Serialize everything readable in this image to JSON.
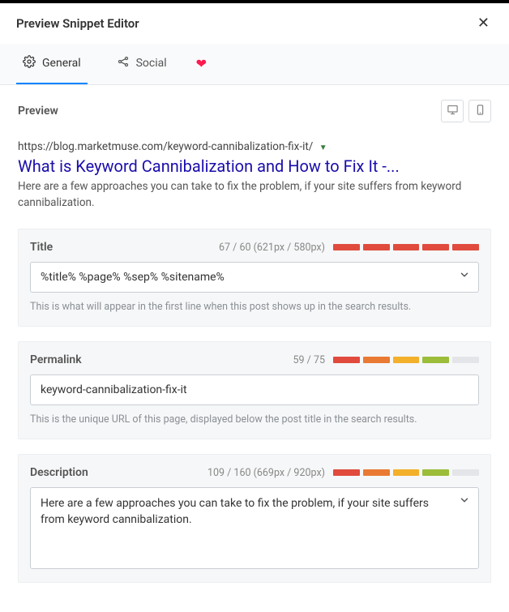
{
  "header": {
    "title": "Preview Snippet Editor"
  },
  "tabs": {
    "general": "General",
    "social": "Social"
  },
  "preview_heading": "Preview",
  "serp": {
    "url_display": "https://blog.marketmuse.com/keyword-cannibalization-fix-it/",
    "title": "What is Keyword Cannibalization and How to Fix It -...",
    "description": "Here are a few approaches you can take to fix the problem, if your site suffers from keyword cannibalization."
  },
  "title_panel": {
    "label": "Title",
    "counter": "67 / 60 (621px / 580px)",
    "value": "%title% %page% %sep% %sitename%",
    "hint": "This is what will appear in the first line when this post shows up in the search results.",
    "bar_colors": [
      "#e04b3e",
      "#e04b3e",
      "#e04b3e",
      "#e04b3e",
      "#e04b3e"
    ]
  },
  "permalink_panel": {
    "label": "Permalink",
    "counter": "59 / 75",
    "value": "keyword-cannibalization-fix-it",
    "hint": "This is the unique URL of this page, displayed below the post title in the search results.",
    "bar_colors": [
      "#e04b3e",
      "#e97a33",
      "#f3b02a",
      "#9bbd3a",
      "#e3e5e8"
    ]
  },
  "description_panel": {
    "label": "Description",
    "counter": "109 / 160 (669px / 920px)",
    "value": "Here are a few approaches you can take to fix the problem, if your site suffers from keyword cannibalization.",
    "bar_colors": [
      "#e04b3e",
      "#e97a33",
      "#f3b02a",
      "#9bbd3a",
      "#e3e5e8"
    ]
  }
}
